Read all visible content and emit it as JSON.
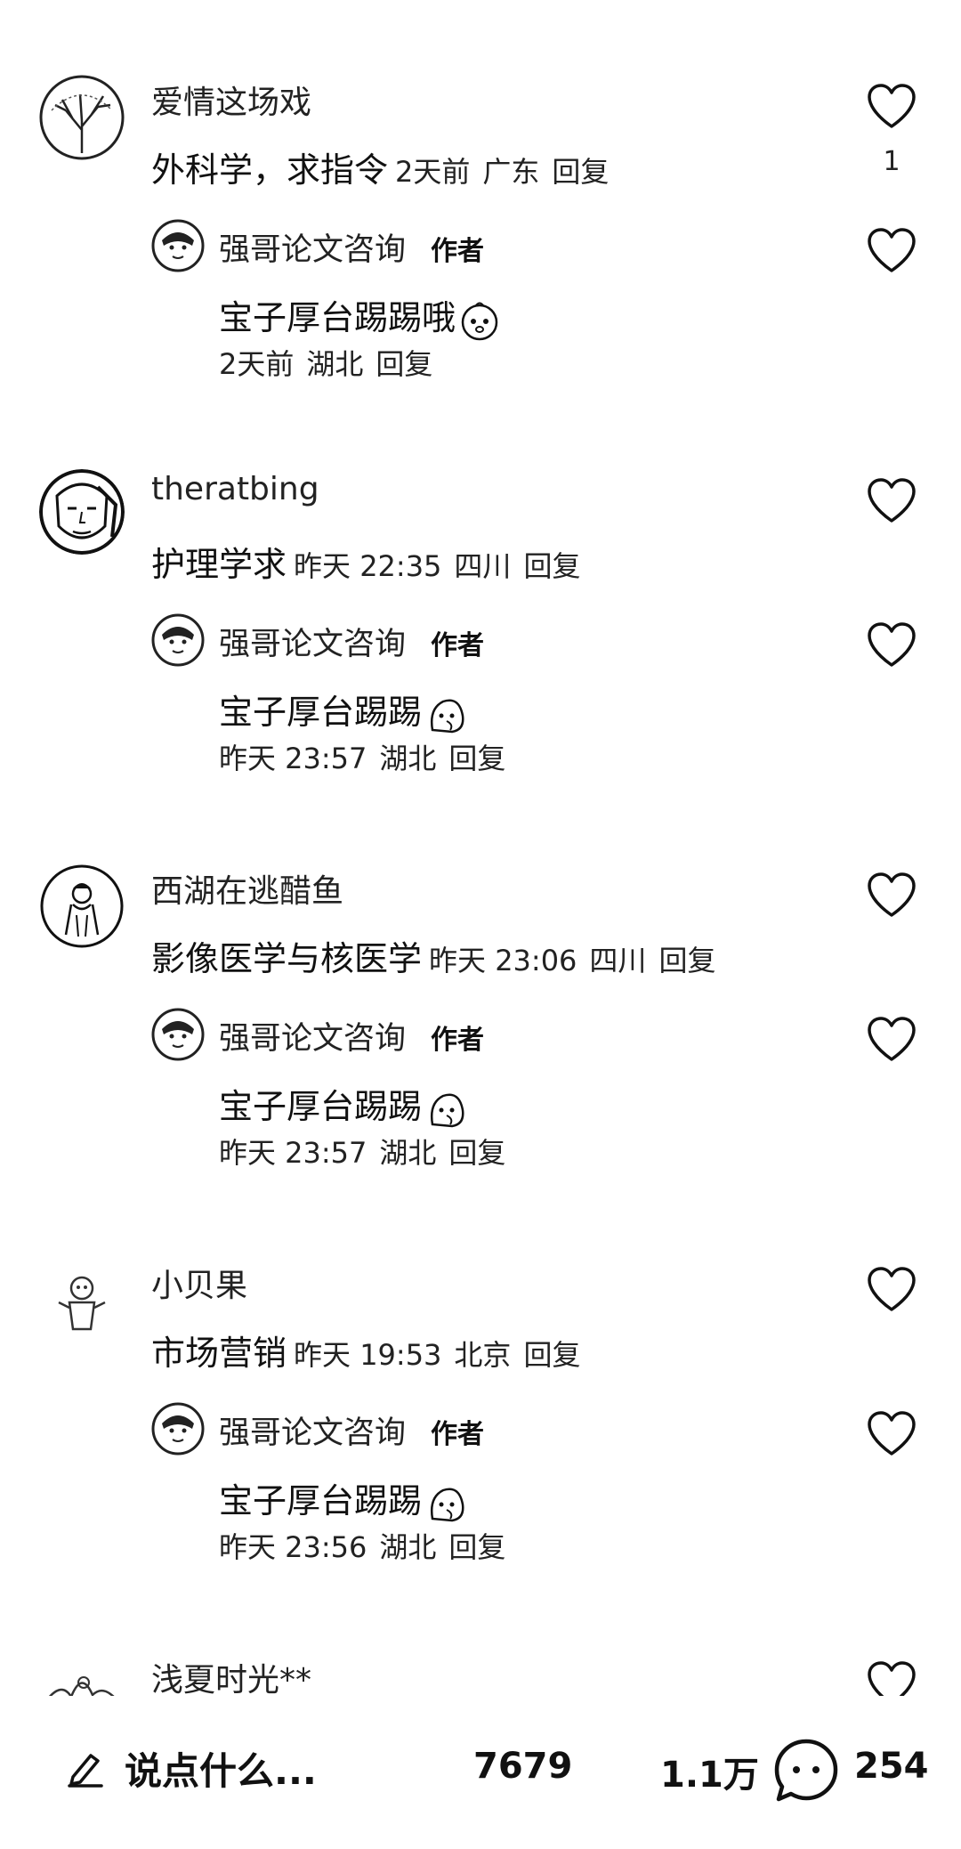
{
  "comments": [
    {
      "username": "爱情这场戏",
      "text": "外科学，求指令",
      "time": "2天前",
      "location": "广东",
      "reply_label": "回复",
      "likes": "1",
      "author_reply": {
        "username": "强哥论文咨询",
        "badge": "作者",
        "text": "宝子厚台踢踢哦",
        "time": "2天前",
        "location": "湖北",
        "reply_label": "回复"
      }
    },
    {
      "username": "theratbing",
      "text": "护理学求",
      "time": "昨天 22:35",
      "location": "四川",
      "reply_label": "回复",
      "author_reply": {
        "username": "强哥论文咨询",
        "badge": "作者",
        "text": "宝子厚台踢踢",
        "time": "昨天 23:57",
        "location": "湖北",
        "reply_label": "回复"
      }
    },
    {
      "username": "西湖在逃醋鱼",
      "text": "影像医学与核医学",
      "time": "昨天 23:06",
      "location": "四川",
      "reply_label": "回复",
      "author_reply": {
        "username": "强哥论文咨询",
        "badge": "作者",
        "text": "宝子厚台踢踢",
        "time": "昨天 23:57",
        "location": "湖北",
        "reply_label": "回复"
      }
    },
    {
      "username": "小贝果",
      "text": "市场营销",
      "time": "昨天 19:53",
      "location": "北京",
      "reply_label": "回复",
      "author_reply": {
        "username": "强哥论文咨询",
        "badge": "作者",
        "text": "宝子厚台踢踢",
        "time": "昨天 23:56",
        "location": "湖北",
        "reply_label": "回复"
      }
    },
    {
      "username": "浅夏时光**"
    }
  ],
  "bottom_bar": {
    "input_placeholder": "说点什么...",
    "like_count": "7679",
    "favorite_count": "1.1万",
    "comment_count": "254",
    "icons": [
      "pen-icon",
      "comment-bubble-icon",
      "heart-icon"
    ]
  }
}
